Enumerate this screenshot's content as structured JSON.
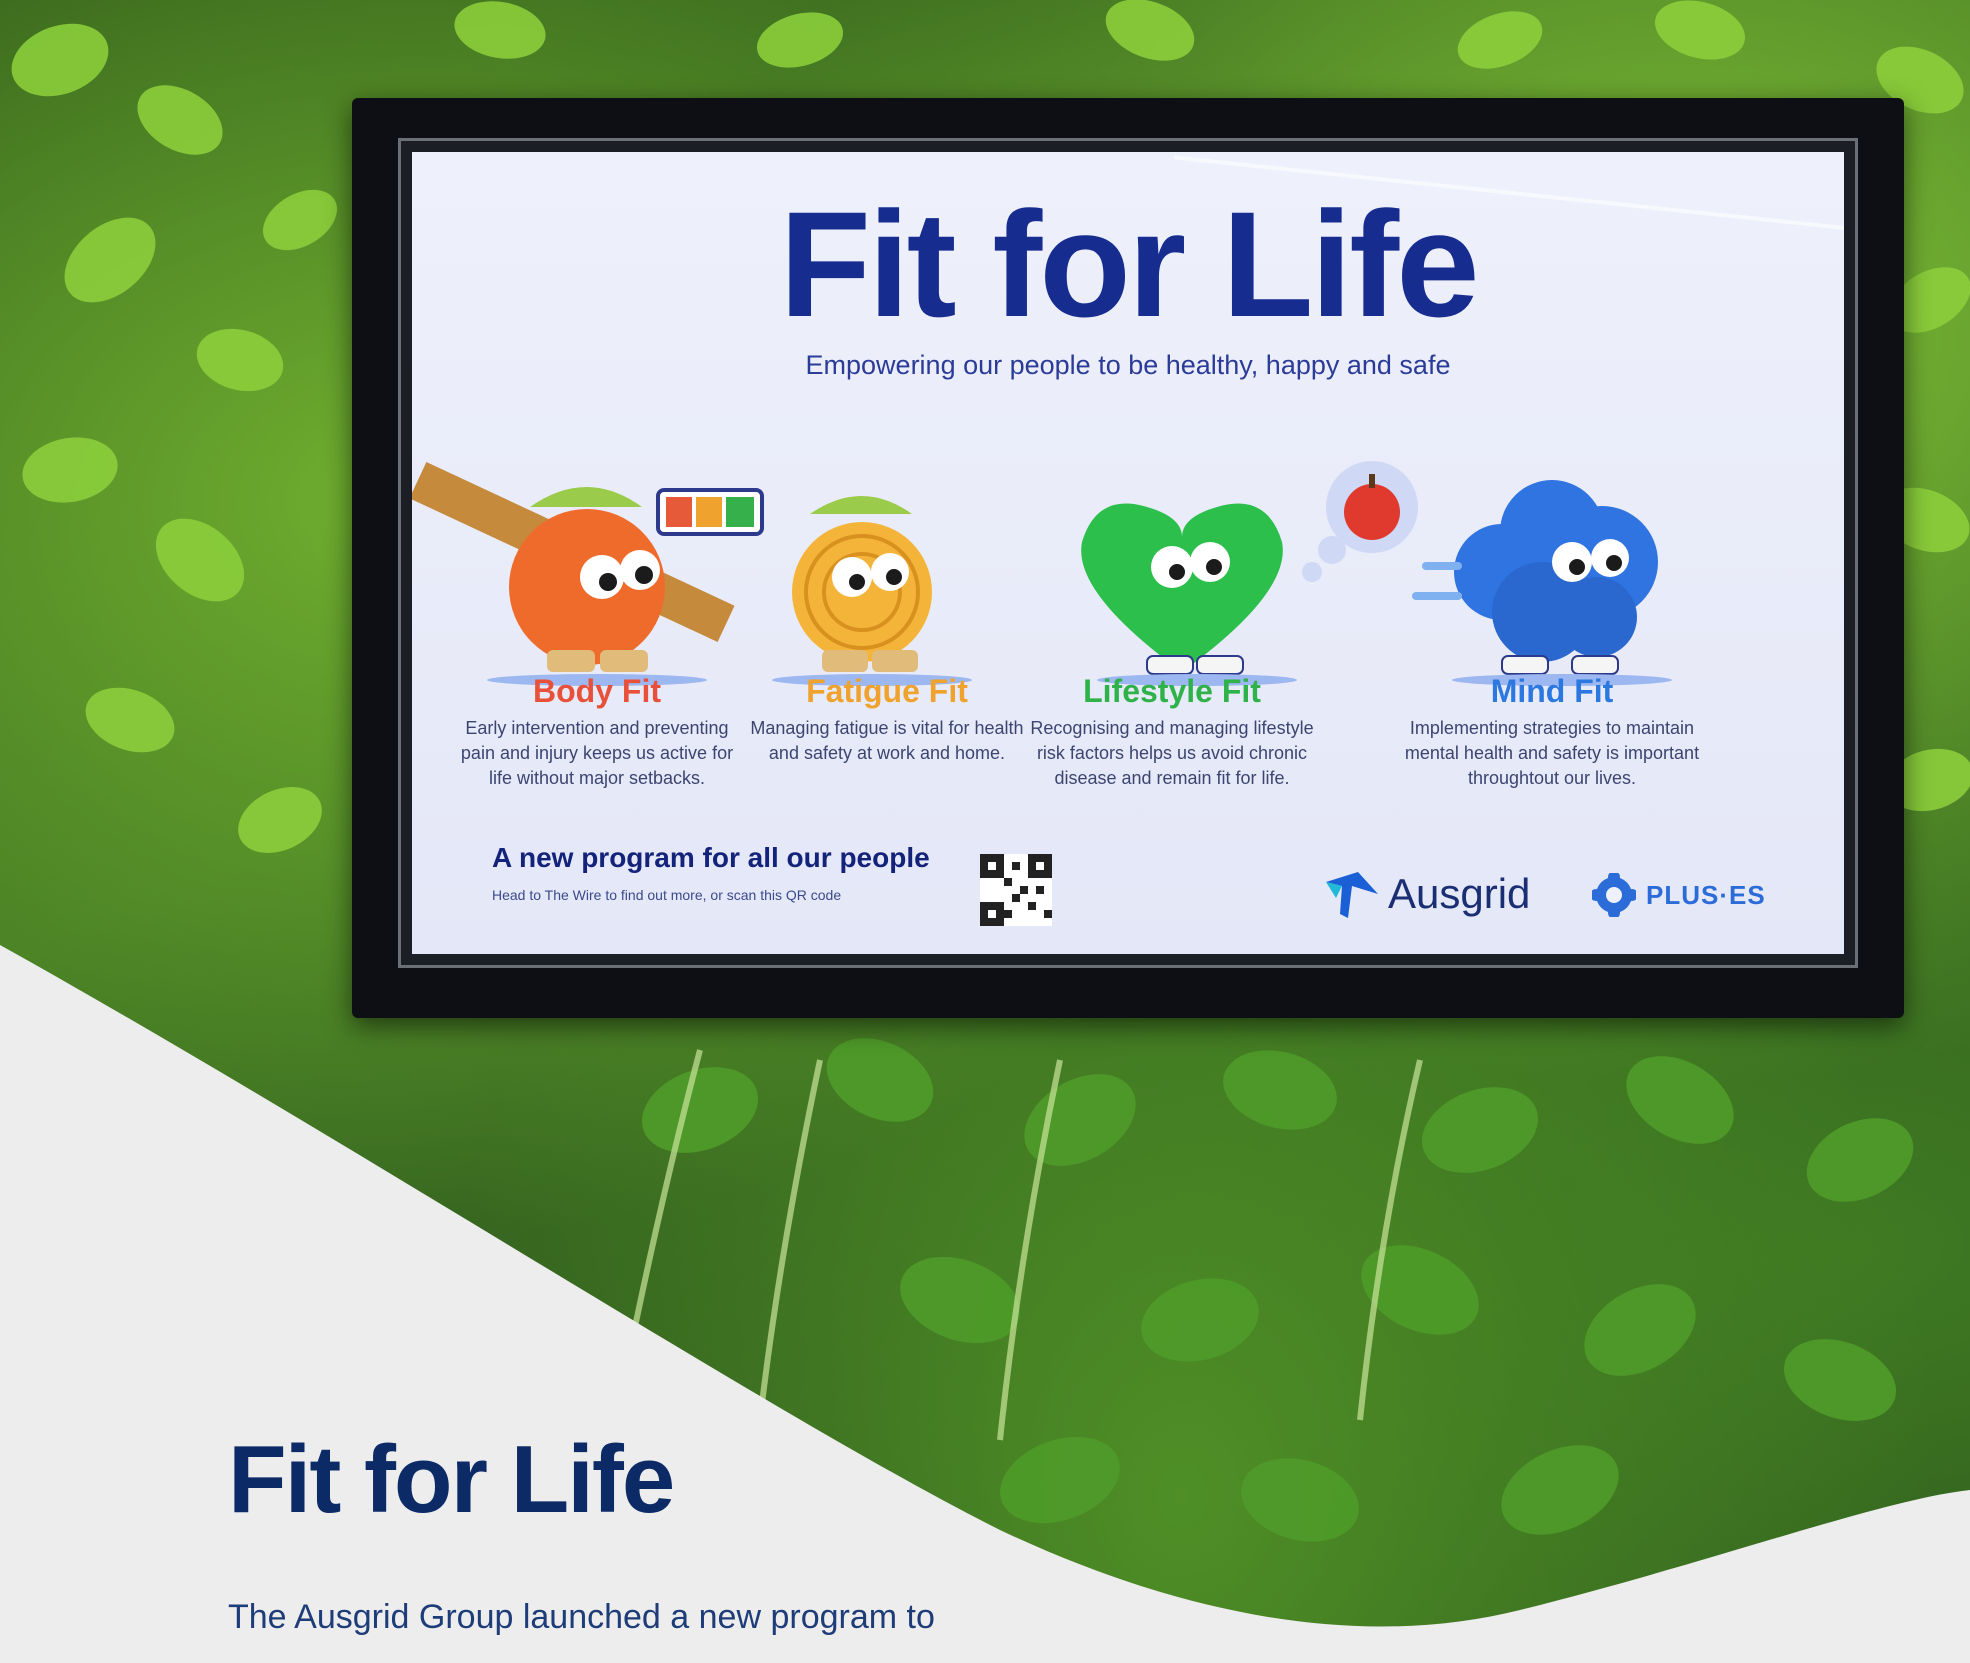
{
  "screen": {
    "title": "Fit for Life",
    "subtitle": "Empowering our people to be healthy, happy and safe",
    "pillars": [
      {
        "title": "Body Fit",
        "description": "Early intervention and preventing pain and injury keeps us active for life without major setbacks.",
        "color": "#e8503a"
      },
      {
        "title": "Fatigue Fit",
        "description": "Managing fatigue is vital for health and safety at work and home.",
        "color": "#f0a22e"
      },
      {
        "title": "Lifestyle Fit",
        "description": "Recognising and managing lifestyle risk factors helps us avoid chronic disease and remain fit for life.",
        "color": "#2fb24a"
      },
      {
        "title": "Mind Fit",
        "description": "Implementing strategies to maintain mental health and safety is important throughtout our lives.",
        "color": "#2a78e0"
      }
    ],
    "cta_title": "A new program for all our people",
    "cta_subtitle": "Head to The Wire to find out more, or scan this QR code",
    "brand_ausgrid": "Ausgrid",
    "brand_plus": "PLUS·ES"
  },
  "article": {
    "title": "Fit for Life",
    "body_line": "The Ausgrid Group launched a new program to"
  },
  "colors": {
    "navy": "#0c2a66",
    "screen_title": "#162c8f",
    "page_background": "#ededee"
  }
}
